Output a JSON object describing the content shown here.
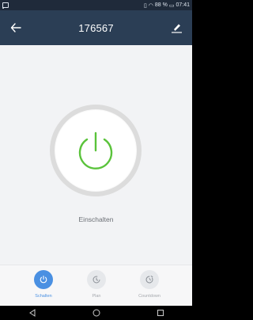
{
  "status_bar": {
    "battery": "88 %",
    "time": "07:41"
  },
  "header": {
    "title": "176567",
    "back_icon": "arrow-left-icon",
    "edit_icon": "pencil-icon"
  },
  "device": {
    "state_label": "Einschalten",
    "power_icon": "power-icon"
  },
  "bottom_nav": {
    "items": [
      {
        "label": "Schalten",
        "icon": "power-icon"
      },
      {
        "label": "Plan",
        "icon": "clock-icon"
      },
      {
        "label": "Countdown",
        "icon": "timer-icon"
      }
    ]
  },
  "colors": {
    "header_bg": "#2b3e55",
    "power_green": "#5ac33b",
    "accent_blue": "#4a90e2"
  }
}
